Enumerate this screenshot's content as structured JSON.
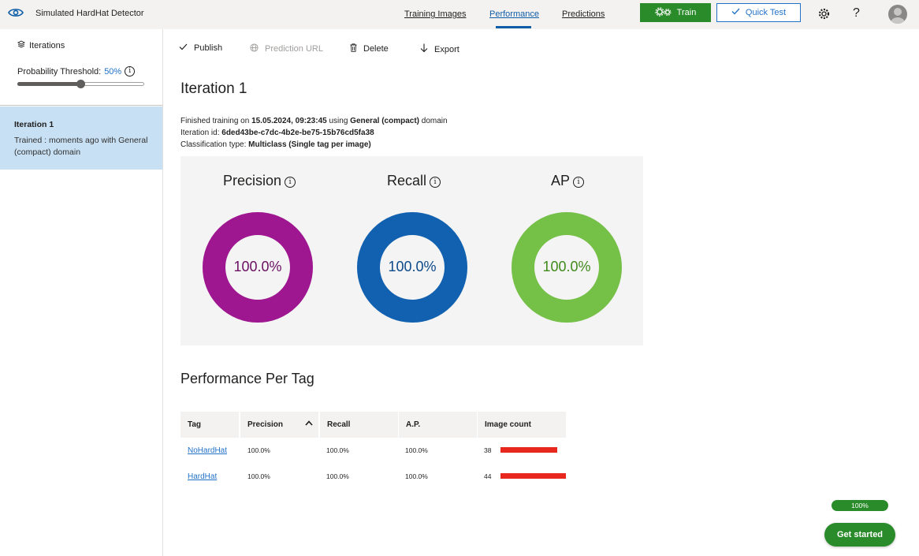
{
  "app": {
    "title": "Simulated HardHat Detector"
  },
  "nav": {
    "tabs": [
      {
        "label": "Training Images",
        "active": false
      },
      {
        "label": "Performance",
        "active": true
      },
      {
        "label": "Predictions",
        "active": false
      }
    ],
    "train_label": "Train",
    "quick_test_label": "Quick Test",
    "help_label": "?"
  },
  "sidebar": {
    "iterations_label": "Iterations",
    "threshold_label": "Probability Threshold:",
    "threshold_value": "50%",
    "threshold_fraction": 0.5,
    "items": [
      {
        "title": "Iteration 1",
        "description": "Trained : moments ago with General (compact) domain"
      }
    ]
  },
  "toolbar": {
    "publish": "Publish",
    "prediction_url": "Prediction URL",
    "delete": "Delete",
    "export": "Export"
  },
  "iteration": {
    "title": "Iteration 1",
    "finished_prefix": "Finished training on",
    "finished_date": "15.05.2024, 09:23:45",
    "using_word": "using",
    "domain": "General (compact)",
    "domain_suffix": "domain",
    "id_label": "Iteration id:",
    "id_value": "6ded43be-c7dc-4b2e-be75-15b76cd5fa38",
    "classification_label": "Classification type:",
    "classification_value": "Multiclass (Single tag per image)"
  },
  "metrics": [
    {
      "name": "Precision",
      "value_label": "100.0%",
      "value": 100.0,
      "color": "#9e1690",
      "text_color": "#6b0f62"
    },
    {
      "name": "Recall",
      "value_label": "100.0%",
      "value": 100.0,
      "color": "#1161b0",
      "text_color": "#0d4a8a"
    },
    {
      "name": "AP",
      "value_label": "100.0%",
      "value": 100.0,
      "color": "#75c047",
      "text_color": "#3f8a1a"
    }
  ],
  "per_tag": {
    "title": "Performance Per Tag",
    "columns": [
      "Tag",
      "Precision",
      "Recall",
      "A.P.",
      "Image count"
    ],
    "sort_arrow": "^",
    "rows": [
      {
        "tag": "NoHardHat",
        "precision": "100.0%",
        "recall": "100.0%",
        "ap": "100.0%",
        "image_count": "38",
        "count_value": 38
      },
      {
        "tag": "HardHat",
        "precision": "100.0%",
        "recall": "100.0%",
        "ap": "100.0%",
        "image_count": "44",
        "count_value": 44
      }
    ]
  },
  "footer": {
    "progress_label": "100%",
    "progress_fraction": 1.0,
    "get_started": "Get started"
  },
  "colors": {
    "accent": "#0f5ca7",
    "train_green": "#2a8b2a",
    "bar_red": "#e8281f",
    "selected_bg": "#c7e0f4"
  }
}
